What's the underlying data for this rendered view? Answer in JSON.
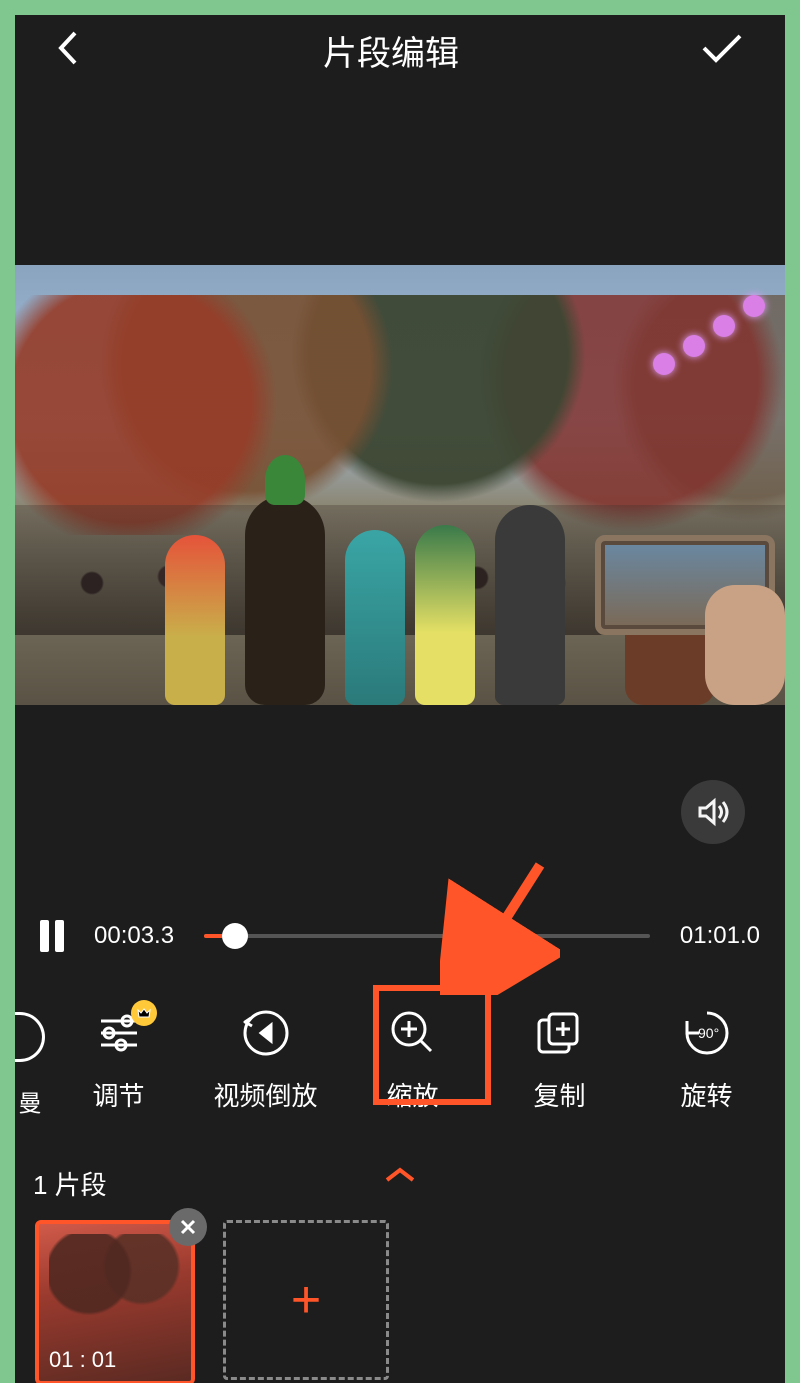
{
  "header": {
    "title": "片段编辑"
  },
  "playback": {
    "current_time": "00:03.3",
    "total_time": "01:01.0",
    "progress_pct": 7
  },
  "toolbar": {
    "partial_left_label": "曼",
    "items": [
      {
        "id": "adjust",
        "label": "调节",
        "premium": true
      },
      {
        "id": "reverse",
        "label": "视频倒放"
      },
      {
        "id": "zoom",
        "label": "缩放",
        "highlighted": true
      },
      {
        "id": "copy",
        "label": "复制"
      },
      {
        "id": "rotate",
        "label": "旋转"
      }
    ]
  },
  "segments": {
    "count_label": "1 片段",
    "clips": [
      {
        "duration": "01 : 01"
      }
    ]
  },
  "annotation": {
    "arrow_target": "zoom",
    "arrow_color": "#ff5528"
  }
}
